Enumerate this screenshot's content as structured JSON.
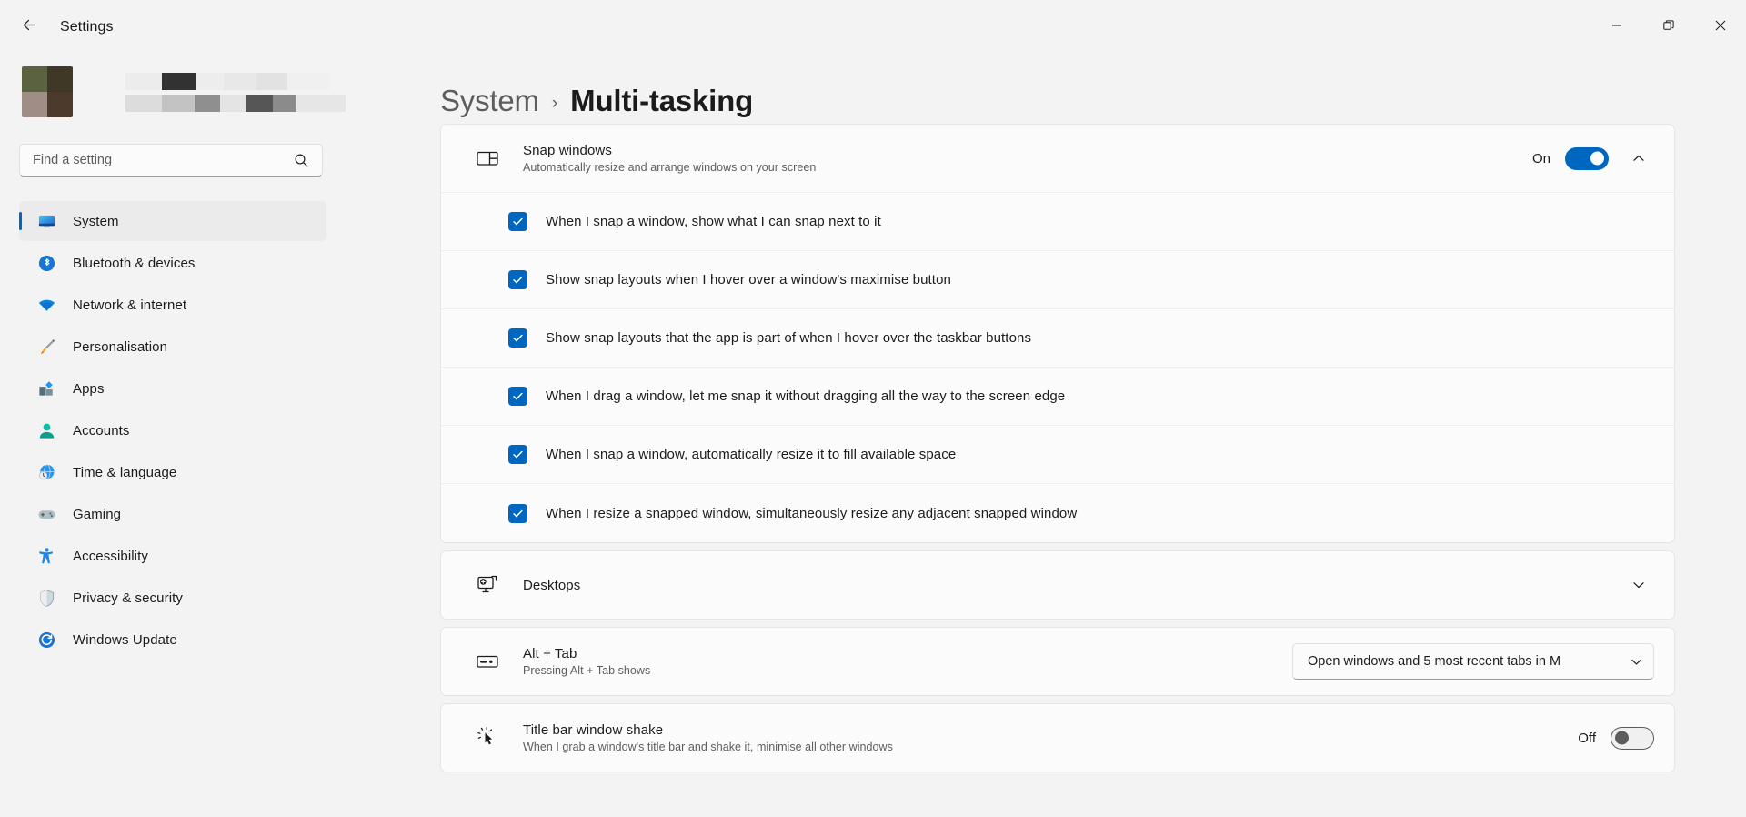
{
  "window": {
    "title": "Settings",
    "back_icon": "arrow-left-icon",
    "controls": {
      "minimize": "minimize-icon",
      "maximize": "restore-icon",
      "close": "close-icon"
    }
  },
  "sidebar": {
    "profile": {
      "redacted": true,
      "avatar_colors": [
        "#5b6240",
        "#403827",
        "#a08e86",
        "#4c3a2d"
      ]
    },
    "search": {
      "placeholder": "Find a setting",
      "value": "",
      "icon": "search-icon"
    },
    "items": [
      {
        "label": "System",
        "icon": "system-icon",
        "selected": true
      },
      {
        "label": "Bluetooth & devices",
        "icon": "bluetooth-icon",
        "selected": false
      },
      {
        "label": "Network & internet",
        "icon": "wifi-icon",
        "selected": false
      },
      {
        "label": "Personalisation",
        "icon": "paintbrush-icon",
        "selected": false
      },
      {
        "label": "Apps",
        "icon": "apps-icon",
        "selected": false
      },
      {
        "label": "Accounts",
        "icon": "account-icon",
        "selected": false
      },
      {
        "label": "Time & language",
        "icon": "globe-clock-icon",
        "selected": false
      },
      {
        "label": "Gaming",
        "icon": "gamepad-icon",
        "selected": false
      },
      {
        "label": "Accessibility",
        "icon": "accessibility-icon",
        "selected": false
      },
      {
        "label": "Privacy & security",
        "icon": "shield-icon",
        "selected": false
      },
      {
        "label": "Windows Update",
        "icon": "update-icon",
        "selected": false
      }
    ]
  },
  "breadcrumb": {
    "parent": "System",
    "separator": "›",
    "current": "Multi-tasking"
  },
  "main": {
    "snap_windows": {
      "title": "Snap windows",
      "subtitle": "Automatically resize and arrange windows on your screen",
      "icon": "snap-layout-icon",
      "toggle_state": "On",
      "toggle_on": true,
      "expander_icon": "chevron-up-icon",
      "expanded": true,
      "options": [
        {
          "label": "When I snap a window, show what I can snap next to it",
          "checked": true
        },
        {
          "label": "Show snap layouts when I hover over a window's maximise button",
          "checked": true
        },
        {
          "label": "Show snap layouts that the app is part of when I hover over the taskbar buttons",
          "checked": true
        },
        {
          "label": "When I drag a window, let me snap it without dragging all the way to the screen edge",
          "checked": true
        },
        {
          "label": "When I snap a window, automatically resize it to fill available space",
          "checked": true
        },
        {
          "label": "When I resize a snapped window, simultaneously resize any adjacent snapped window",
          "checked": true
        }
      ]
    },
    "desktops": {
      "title": "Desktops",
      "icon": "desktops-icon",
      "expander_icon": "chevron-down-icon",
      "expanded": false
    },
    "alt_tab": {
      "title": "Alt + Tab",
      "subtitle": "Pressing Alt + Tab shows",
      "icon": "alt-tab-icon",
      "dropdown_value": "Open windows and 5 most recent tabs in M",
      "dropdown_icon": "chevron-down-icon"
    },
    "title_bar_shake": {
      "title": "Title bar window shake",
      "subtitle": "When I grab a window's title bar and shake it, minimise all other windows",
      "icon": "window-shake-icon",
      "toggle_state": "Off",
      "toggle_on": false
    }
  },
  "colors": {
    "accent": "#0067c0",
    "page_bg": "#f3f3f3",
    "card_bg": "#fbfbfb",
    "text_primary": "#1b1b1b",
    "text_secondary": "#5d5d5d"
  }
}
